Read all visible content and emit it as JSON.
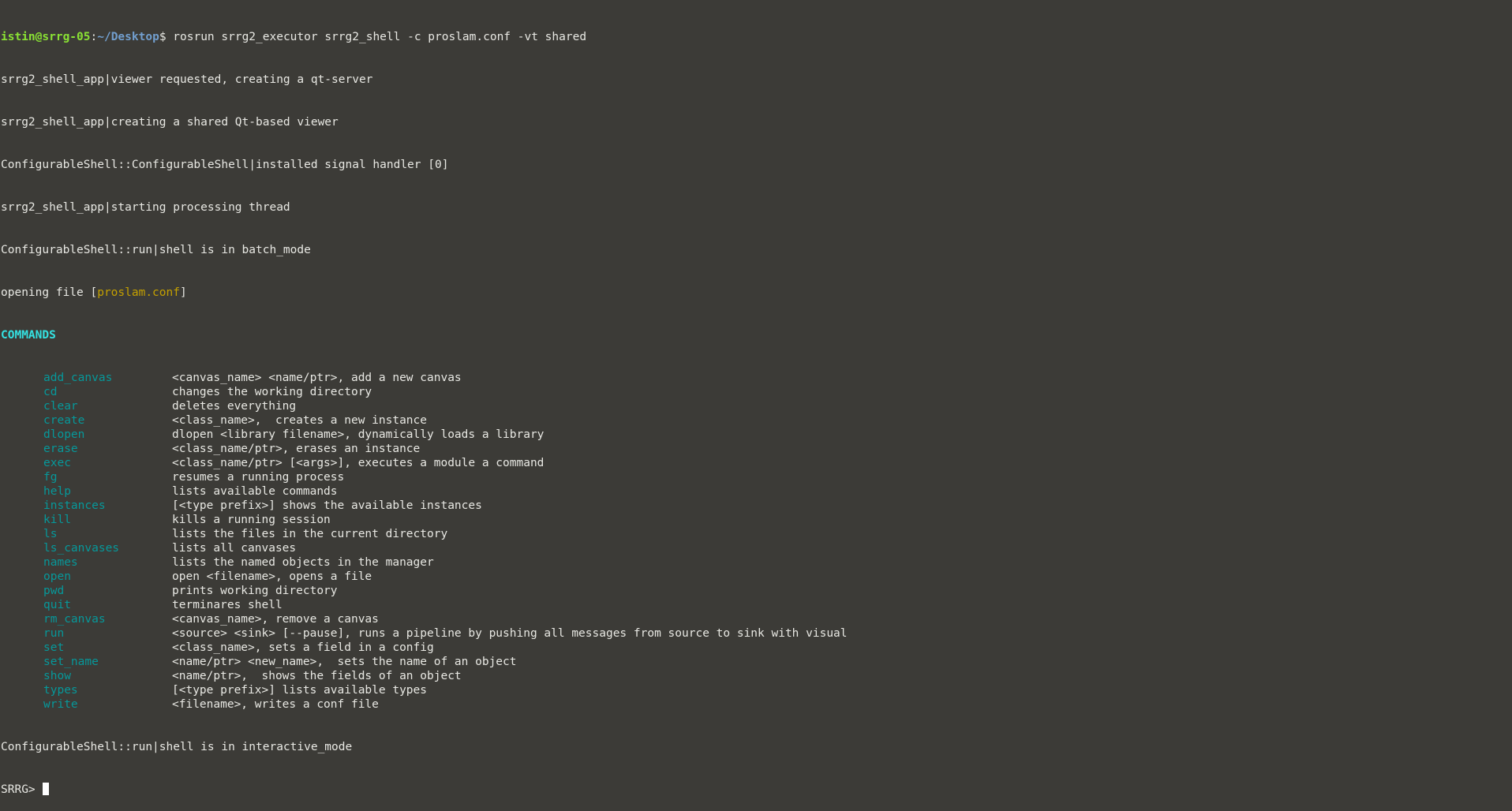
{
  "prompt": {
    "user_host": "istin@srrg-05",
    "sep": ":",
    "path": "~/Desktop",
    "symbol": "$",
    "command": " rosrun srrg2_executor srrg2_shell -c proslam.conf -vt shared"
  },
  "log_lines": [
    "srrg2_shell_app|viewer requested, creating a qt-server",
    "srrg2_shell_app|creating a shared Qt-based viewer",
    "ConfigurableShell::ConfigurableShell|installed signal handler [0]",
    "srrg2_shell_app|starting processing thread",
    "ConfigurableShell::run|shell is in batch_mode"
  ],
  "opening": {
    "prefix": "opening file [",
    "file": "proslam.conf",
    "suffix": "]"
  },
  "commands_header": "COMMANDS",
  "commands": [
    {
      "name": "add_canvas",
      "desc": "<canvas_name> <name/ptr>, add a new canvas"
    },
    {
      "name": "cd",
      "desc": "changes the working directory"
    },
    {
      "name": "clear",
      "desc": "deletes everything"
    },
    {
      "name": "create",
      "desc": "<class_name>,  creates a new instance"
    },
    {
      "name": "dlopen",
      "desc": "dlopen <library filename>, dynamically loads a library"
    },
    {
      "name": "erase",
      "desc": "<class_name/ptr>, erases an instance"
    },
    {
      "name": "exec",
      "desc": "<class_name/ptr> [<args>], executes a module a command"
    },
    {
      "name": "fg",
      "desc": "resumes a running process"
    },
    {
      "name": "help",
      "desc": "lists available commands"
    },
    {
      "name": "instances",
      "desc": "[<type prefix>] shows the available instances"
    },
    {
      "name": "kill",
      "desc": "kills a running session"
    },
    {
      "name": "ls",
      "desc": "lists the files in the current directory"
    },
    {
      "name": "ls_canvases",
      "desc": "lists all canvases"
    },
    {
      "name": "names",
      "desc": "lists the named objects in the manager"
    },
    {
      "name": "open",
      "desc": "open <filename>, opens a file"
    },
    {
      "name": "pwd",
      "desc": "prints working directory"
    },
    {
      "name": "quit",
      "desc": "terminares shell"
    },
    {
      "name": "rm_canvas",
      "desc": "<canvas_name>, remove a canvas"
    },
    {
      "name": "run",
      "desc": "<source> <sink> [--pause], runs a pipeline by pushing all messages from source to sink with visual"
    },
    {
      "name": "set",
      "desc": "<class_name>, sets a field in a config"
    },
    {
      "name": "set_name",
      "desc": "<name/ptr> <new_name>,  sets the name of an object"
    },
    {
      "name": "show",
      "desc": "<name/ptr>,  shows the fields of an object"
    },
    {
      "name": "types",
      "desc": "[<type prefix>] lists available types"
    },
    {
      "name": "write",
      "desc": "<filename>, writes a conf file"
    }
  ],
  "final_status": "ConfigurableShell::run|shell is in interactive_mode",
  "shell_prompt": "SRRG> ",
  "colors": {
    "background": "#3c3b37",
    "text": "#e8e8e3",
    "user_host": "#8ae234",
    "path": "#729fcf",
    "commands_header": "#34e2e2",
    "command_name": "#06989a",
    "file_name": "#c4a000"
  }
}
